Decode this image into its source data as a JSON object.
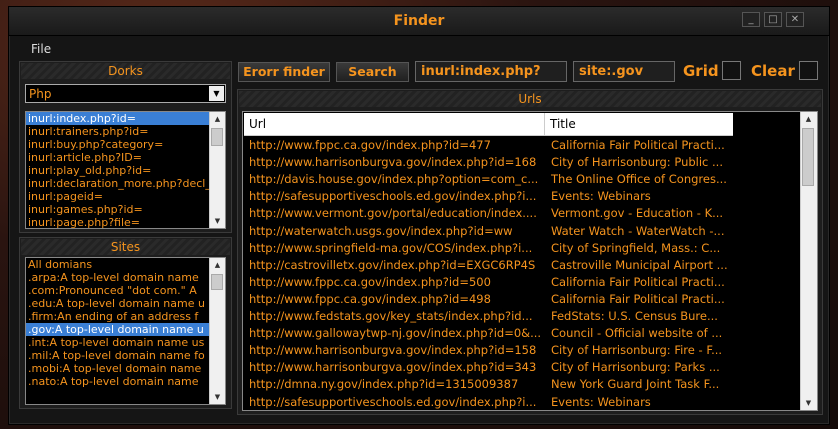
{
  "window": {
    "title": "Finder",
    "controls": [
      "_",
      "□",
      "✕"
    ]
  },
  "menu": {
    "file": "File"
  },
  "dorks": {
    "header": "Dorks",
    "selected_category": "Php",
    "items": [
      "inurl:index.php?id=",
      "inurl:trainers.php?id=",
      "inurl:buy.php?category=",
      "inurl:article.php?ID=",
      "inurl:play_old.php?id=",
      "inurl:declaration_more.php?decl_id=",
      "inurl:pageid=",
      "inurl:games.php?id=",
      "inurl:page.php?file="
    ],
    "selected_index": 0
  },
  "sites": {
    "header": "Sites",
    "items": [
      "All domians",
      ".arpa:A top-level domain name",
      ".com:Pronounced \"dot com.\" A",
      ".edu:A top-level domain name u",
      ".firm:An ending of an address f",
      ".gov:A top-level domain name u",
      ".int:A top-level domain name us",
      ".mil:A top-level domain name fo",
      ".mobi:A top-level domain name",
      ".nato:A top-level domain name"
    ],
    "selected_index": 5
  },
  "toolbar": {
    "error_finder": "Erorr finder",
    "search": "Search",
    "dork_value": "inurl:index.php?",
    "site_value": "site:.gov",
    "grid_label": "Grid",
    "clear_label": "Clear"
  },
  "urls": {
    "header": "Urls",
    "columns": [
      "Url",
      "Title"
    ],
    "rows": [
      [
        "http://www.fppc.ca.gov/index.php?id=477",
        "California Fair Political Practi..."
      ],
      [
        "http://www.harrisonburgva.gov/index.php?id=168",
        "City of Harrisonburg: Public ..."
      ],
      [
        "http://davis.house.gov/index.php?option=com_c...",
        "The Online Office of Congres..."
      ],
      [
        "http://safesupportiveschools.ed.gov/index.php?i...",
        "Events: Webinars"
      ],
      [
        "http://www.vermont.gov/portal/education/index....",
        "Vermont.gov - Education - K..."
      ],
      [
        "http://waterwatch.usgs.gov/index.php?id=ww",
        "Water Watch - WaterWatch -..."
      ],
      [
        "http://www.springfield-ma.gov/COS/index.php?i...",
        "City of Springfield, Mass.: C..."
      ],
      [
        "http://castrovilletx.gov/index.php?id=EXGC6RP4S",
        "Castroville Municipal Airport ..."
      ],
      [
        "http://www.fppc.ca.gov/index.php?id=500",
        "California Fair Political Practi..."
      ],
      [
        "http://www.fppc.ca.gov/index.php?id=498",
        "California Fair Political Practi..."
      ],
      [
        "http://www.fedstats.gov/key_stats/index.php?id...",
        "FedStats: U.S. Census Bure..."
      ],
      [
        "http://www.gallowaytwp-nj.gov/index.php?id=0&...",
        "Council - Official website of ..."
      ],
      [
        "http://www.harrisonburgva.gov/index.php?id=158",
        "City of Harrisonburg: Fire - F..."
      ],
      [
        "http://www.harrisonburgva.gov/index.php?id=343",
        "City of Harrisonburg: Parks ..."
      ],
      [
        "http://dmna.ny.gov/index.php?id=1315009387",
        "New York Guard Joint Task F..."
      ],
      [
        "http://safesupportiveschools.ed.gov/index.php?i...",
        "Events: Webinars"
      ]
    ]
  },
  "colors": {
    "accent": "#f5941e",
    "selection": "#3a7fd5",
    "background": "#151515"
  }
}
